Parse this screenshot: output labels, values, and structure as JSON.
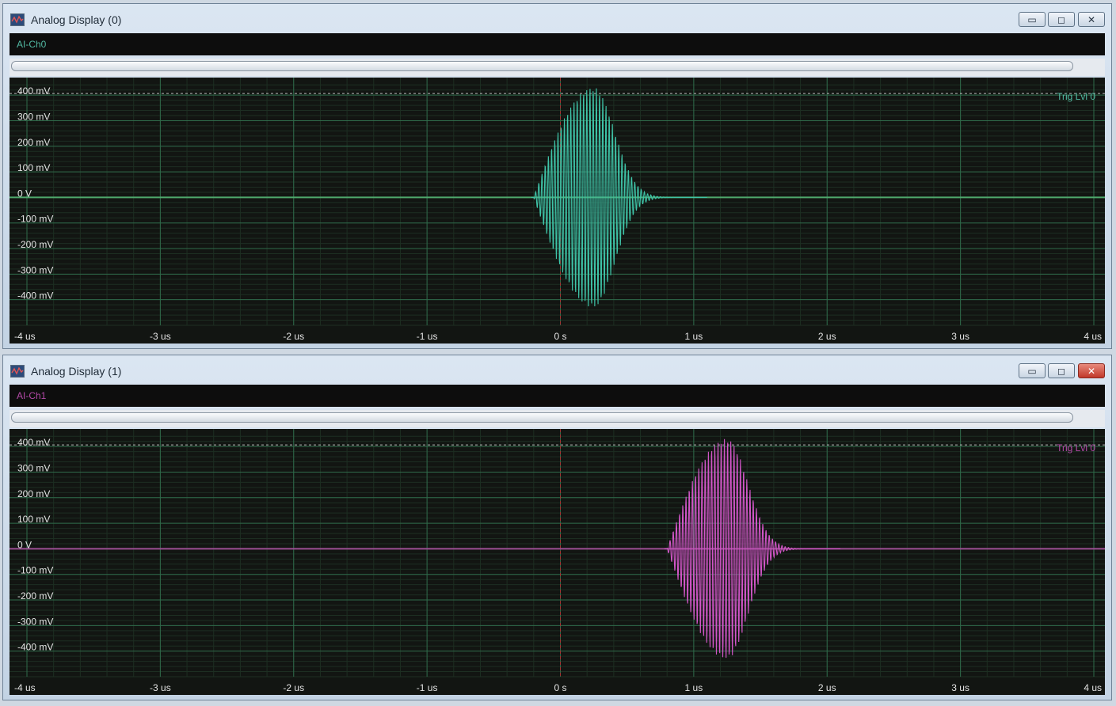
{
  "windows": [
    {
      "title": "Analog Display (0)",
      "channel": "AI-Ch0",
      "trigger_label": "Trig Lvl 0",
      "trace_color": "#3fc4a8",
      "label_color": "#52b9a3",
      "zero_line_color": "#4ea86b"
    },
    {
      "title": "Analog Display (1)",
      "channel": "AI-Ch1",
      "trigger_label": "Trig Lvl 0",
      "trace_color": "#d256c8",
      "label_color": "#b44aa8",
      "zero_line_color": "#9d4f95"
    }
  ],
  "window_controls": {
    "minimize": "▭",
    "maximize": "◻",
    "close": "✕"
  },
  "colors": {
    "grid_major": "#2f6a4a",
    "grid_minor": "#1d2e22",
    "axis_text": "#e4e4e4",
    "trigger_line": "#b9b9b9",
    "cursor_line": "#a23232"
  },
  "chart_data": [
    {
      "type": "line",
      "series": [
        {
          "name": "AI-Ch0",
          "burst_start_us": -0.2,
          "peak_us": 0.25,
          "burst_end_us": 0.8,
          "amplitude_mV": 430
        }
      ],
      "x_ticks": [
        "-4 us",
        "-3 us",
        "-2 us",
        "-1 us",
        "0 s",
        "1 us",
        "2 us",
        "3 us",
        "4 us"
      ],
      "y_ticks": [
        "400 mV",
        "300 mV",
        "200 mV",
        "100 mV",
        "0 V",
        "-100 mV",
        "-200 mV",
        "-300 mV",
        "-400 mV"
      ],
      "xlim": [
        -4,
        4
      ],
      "ylim": [
        -500,
        450
      ],
      "trigger_level_mV": 400
    },
    {
      "type": "line",
      "series": [
        {
          "name": "AI-Ch1",
          "burst_start_us": 0.8,
          "peak_us": 1.25,
          "burst_end_us": 1.8,
          "amplitude_mV": 430
        }
      ],
      "x_ticks": [
        "-4 us",
        "-3 us",
        "-2 us",
        "-1 us",
        "0 s",
        "1 us",
        "2 us",
        "3 us",
        "4 us"
      ],
      "y_ticks": [
        "400 mV",
        "300 mV",
        "200 mV",
        "100 mV",
        "0 V",
        "-100 mV",
        "-200 mV",
        "-300 mV",
        "-400 mV"
      ],
      "xlim": [
        -4,
        4
      ],
      "ylim": [
        -500,
        450
      ],
      "trigger_level_mV": 400
    }
  ]
}
